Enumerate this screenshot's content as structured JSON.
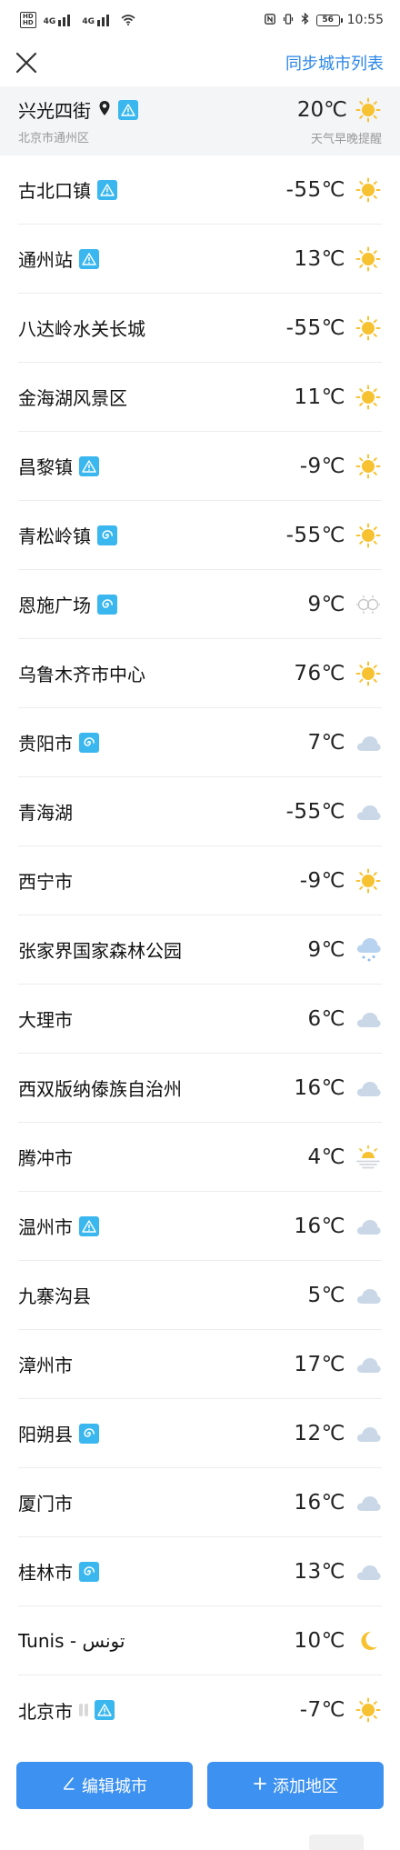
{
  "status_bar": {
    "sim1": "HD",
    "sim2": "HD",
    "net1": "4G",
    "net2": "4G",
    "battery": "56",
    "time": "10:55"
  },
  "header": {
    "close_icon": "close-icon",
    "sync_label": "同步城市列表"
  },
  "current": {
    "name": "兴光四街",
    "sub": "北京市通州区",
    "temp": "20℃",
    "reminder": "天气早晚提醒",
    "icon": "sun"
  },
  "cities": [
    {
      "name": "古北口镇",
      "temp": "-55℃",
      "icon": "sun",
      "badge": "warning"
    },
    {
      "name": "通州站",
      "temp": "13℃",
      "icon": "sun",
      "badge": "warning"
    },
    {
      "name": "八达岭水关长城",
      "temp": "-55℃",
      "icon": "sun",
      "badge": ""
    },
    {
      "name": "金海湖风景区",
      "temp": "11℃",
      "icon": "sun",
      "badge": ""
    },
    {
      "name": "昌黎镇",
      "temp": "-9℃",
      "icon": "sun",
      "badge": "warning"
    },
    {
      "name": "青松岭镇",
      "temp": "-55℃",
      "icon": "sun",
      "badge": "spiral"
    },
    {
      "name": "恩施广场",
      "temp": "9℃",
      "icon": "haze",
      "badge": "spiral"
    },
    {
      "name": "乌鲁木齐市中心",
      "temp": "76℃",
      "icon": "sun",
      "badge": ""
    },
    {
      "name": "贵阳市",
      "temp": "7℃",
      "icon": "cloud",
      "badge": "spiral"
    },
    {
      "name": "青海湖",
      "temp": "-55℃",
      "icon": "cloud",
      "badge": ""
    },
    {
      "name": "西宁市",
      "temp": "-9℃",
      "icon": "sun",
      "badge": ""
    },
    {
      "name": "张家界国家森林公园",
      "temp": "9℃",
      "icon": "snow-cloud",
      "badge": ""
    },
    {
      "name": "大理市",
      "temp": "6℃",
      "icon": "cloud",
      "badge": ""
    },
    {
      "name": "西双版纳傣族自治州",
      "temp": "16℃",
      "icon": "cloud",
      "badge": ""
    },
    {
      "name": "腾冲市",
      "temp": "4℃",
      "icon": "fog-sun",
      "badge": ""
    },
    {
      "name": "温州市",
      "temp": "16℃",
      "icon": "cloud",
      "badge": "warning"
    },
    {
      "name": "九寨沟县",
      "temp": "5℃",
      "icon": "cloud",
      "badge": ""
    },
    {
      "name": "漳州市",
      "temp": "17℃",
      "icon": "cloud",
      "badge": ""
    },
    {
      "name": "阳朔县",
      "temp": "12℃",
      "icon": "cloud",
      "badge": "spiral"
    },
    {
      "name": "厦门市",
      "temp": "16℃",
      "icon": "cloud",
      "badge": ""
    },
    {
      "name": "桂林市",
      "temp": "13℃",
      "icon": "cloud",
      "badge": "spiral"
    },
    {
      "name": "Tunis - تونس",
      "temp": "10℃",
      "icon": "moon",
      "badge": ""
    },
    {
      "name": "北京市",
      "temp": "-7℃",
      "icon": "sun",
      "badge": "drops-warning"
    }
  ],
  "buttons": {
    "edit_label": "编辑城市",
    "add_label": "添加地区"
  },
  "colors": {
    "accent": "#3d91f0",
    "link": "#2a86e8",
    "badge": "#3ab7ee",
    "sun": "#f7c231"
  }
}
